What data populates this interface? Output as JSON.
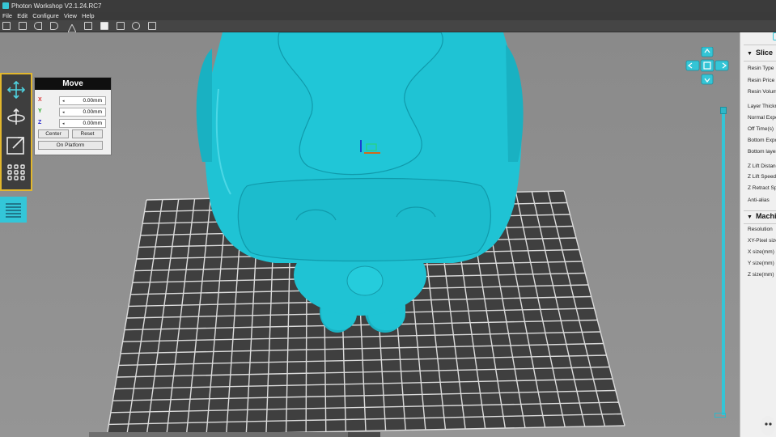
{
  "window": {
    "title": "Photon Workshop V2.1.24.RC7"
  },
  "menu": [
    "File",
    "Edit",
    "Configure",
    "View",
    "Help"
  ],
  "toolbar_icons": [
    "open-icon",
    "save-icon",
    "undo-icon",
    "redo-icon",
    "support-icon",
    "slice-icon",
    "solid-view-icon",
    "text-icon",
    "hollow-icon",
    "settings-icon"
  ],
  "left_tools": [
    {
      "name": "move-tool",
      "icon": "move-arrows-icon",
      "active": true
    },
    {
      "name": "rotate-tool",
      "icon": "rotate-icon",
      "active": false
    },
    {
      "name": "scale-tool",
      "icon": "scale-icon",
      "active": false
    },
    {
      "name": "array-tool",
      "icon": "grid-dots-icon",
      "active": false
    }
  ],
  "move_panel": {
    "title": "Move",
    "x_label": "X",
    "y_label": "Y",
    "z_label": "Z",
    "x_value": "0.00mm",
    "y_value": "0.00mm",
    "z_value": "0.00mm",
    "center_label": "Center",
    "reset_label": "Reset",
    "on_platform_label": "On Platform"
  },
  "right_panel": {
    "slice_title": "Slice",
    "slice_items": [
      "Resin Type",
      "Resin Price",
      "Resin Volume",
      "Layer Thickness",
      "Normal Exposure",
      "Off Time(s)",
      "Bottom Exposure",
      "Bottom layers",
      "Z Lift Distance",
      "Z Lift Speed",
      "Z Retract Speed",
      "Anti-alias"
    ],
    "machine_title": "Machine",
    "machine_items": [
      "Resolution",
      "XY-Pixel size",
      "X size(mm)",
      "Y size(mm)",
      "Z size(mm)"
    ]
  },
  "colors": {
    "model": "#1fc3d4",
    "accent_border": "#e2b72d",
    "platform": "#3f3f3f",
    "grid_line": "#dcdcdc",
    "viewport_bg": "#8d8d8d"
  }
}
